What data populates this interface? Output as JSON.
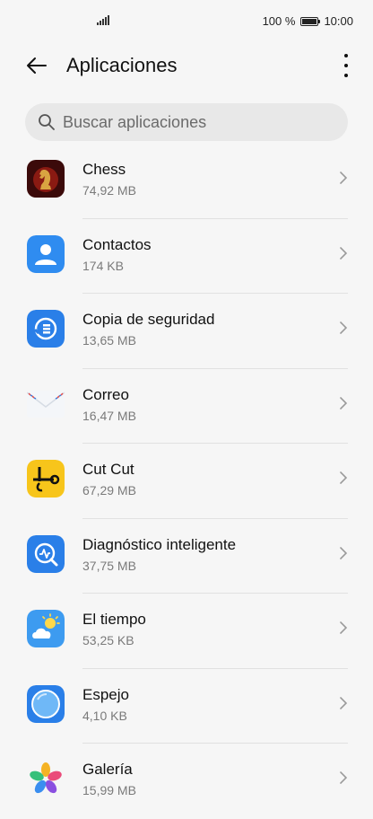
{
  "status_bar": {
    "battery": "100 %",
    "time": "10:00"
  },
  "header": {
    "title": "Aplicaciones"
  },
  "search": {
    "placeholder": "Buscar aplicaciones"
  },
  "apps": [
    {
      "name": "Chess",
      "size": "74,92 MB",
      "icon": "chess-knight-icon"
    },
    {
      "name": "Contactos",
      "size": "174 KB",
      "icon": "contact-person-icon"
    },
    {
      "name": "Copia de seguridad",
      "size": "13,65 MB",
      "icon": "backup-icon"
    },
    {
      "name": "Correo",
      "size": "16,47 MB",
      "icon": "envelope-icon"
    },
    {
      "name": "Cut Cut",
      "size": "67,29 MB",
      "icon": "scissors-icon"
    },
    {
      "name": "Diagnóstico inteligente",
      "size": "37,75 MB",
      "icon": "diagnostics-icon"
    },
    {
      "name": "El tiempo",
      "size": "53,25 KB",
      "icon": "weather-icon"
    },
    {
      "name": "Espejo",
      "size": "4,10 KB",
      "icon": "mirror-icon"
    },
    {
      "name": "Galería",
      "size": "15,99 MB",
      "icon": "gallery-flower-icon"
    }
  ],
  "colors": {
    "background": "#f6f6f6",
    "search_bg": "#e8e8e8",
    "divider": "#e1e1e1"
  }
}
